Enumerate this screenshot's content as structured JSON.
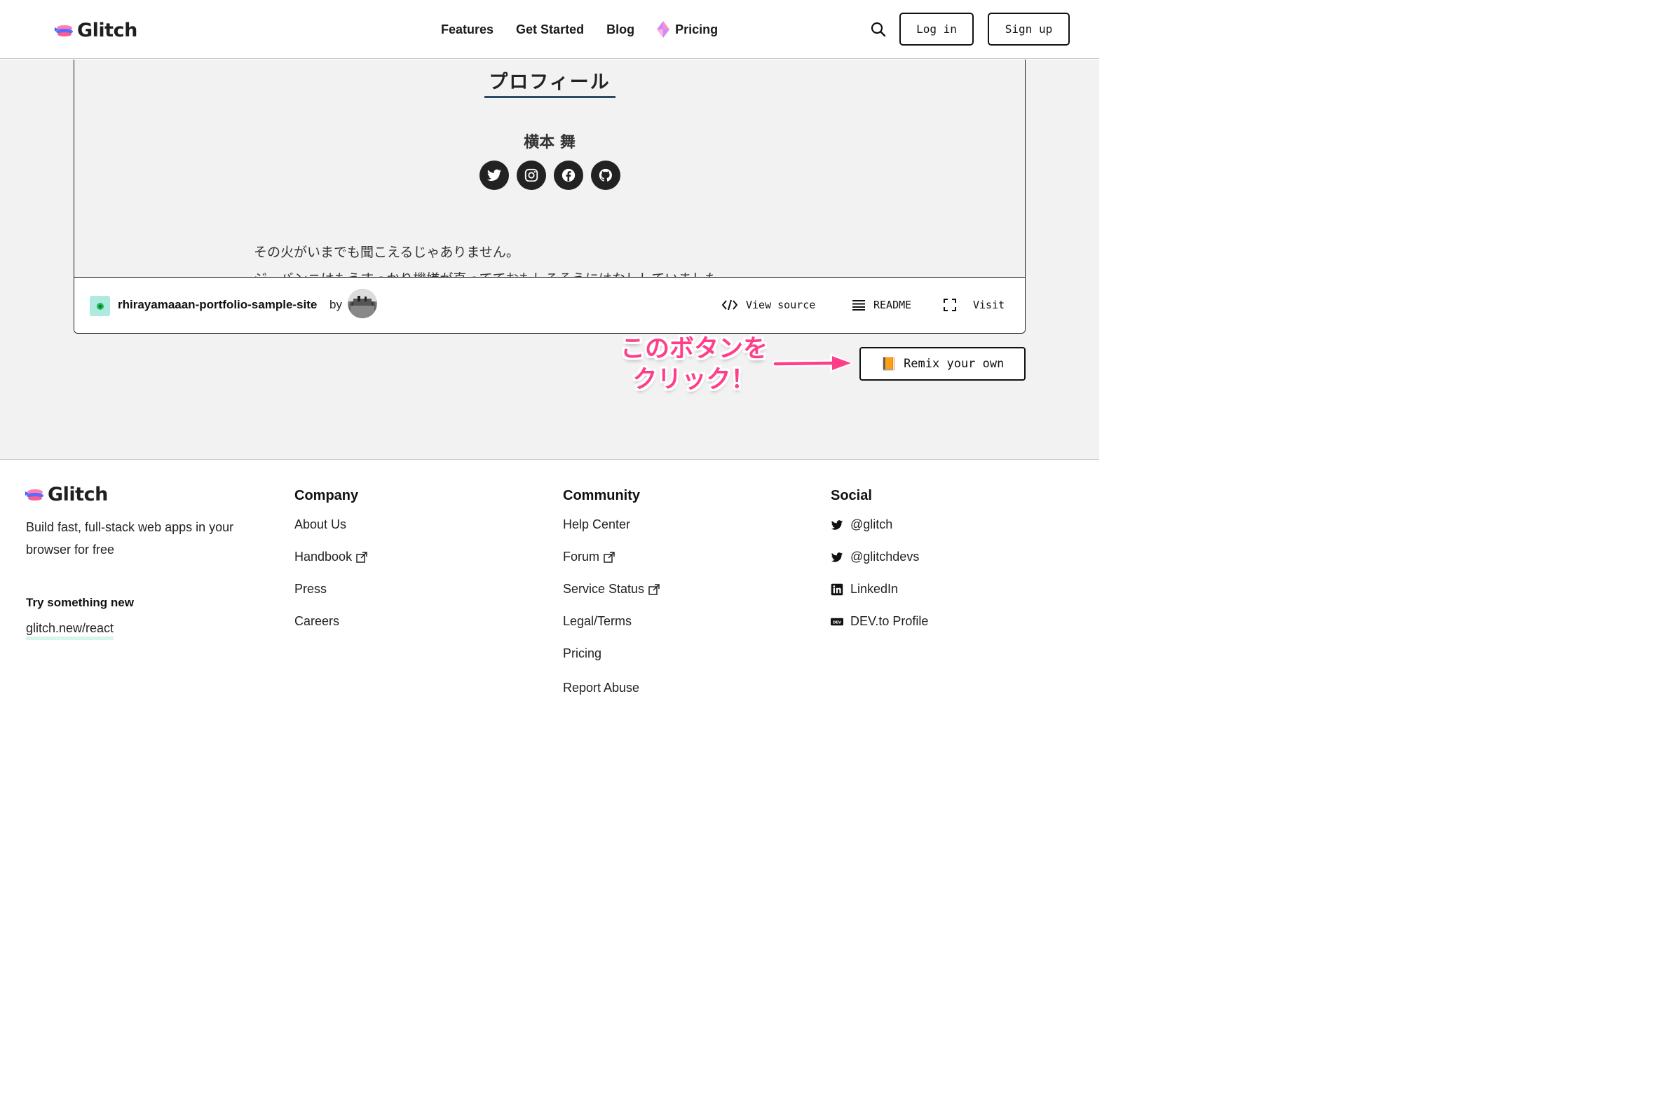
{
  "header": {
    "logo_text": "Glitch",
    "nav": {
      "features": "Features",
      "get_started": "Get Started",
      "blog": "Blog",
      "pricing": "Pricing"
    },
    "login_label": "Log in",
    "signup_label": "Sign up"
  },
  "embed": {
    "profile_title": "プロフィール",
    "profile_name": "横本 舞",
    "social_icons": [
      "twitter-icon",
      "instagram-icon",
      "facebook-icon",
      "github-icon"
    ],
    "body_line1": "その火がいまでも聞こえるじゃありません。",
    "body_line2": "ジーバンニはもうすっかり機嫌が直ってておもしろそうにはなししていました。",
    "project_name": "rhirayamaaan-portfolio-sample-site",
    "by_label": "by",
    "view_source": "View source",
    "readme": "README",
    "visit": "Visit"
  },
  "remix": {
    "label": "Remix your own",
    "emoji": "📙"
  },
  "annotation": {
    "line1": "このボタンを",
    "line2": "クリック！",
    "color": "#ff3e8a"
  },
  "footer": {
    "logo_text": "Glitch",
    "tagline": "Build fast, full-stack web apps in your browser for free",
    "try_heading": "Try something new",
    "try_link": "glitch.new/react",
    "company": {
      "heading": "Company",
      "about": "About Us",
      "handbook": "Handbook",
      "press": "Press",
      "careers": "Careers"
    },
    "community": {
      "heading": "Community",
      "help": "Help Center",
      "forum": "Forum",
      "status": "Service Status",
      "legal": "Legal/Terms",
      "pricing": "Pricing",
      "abuse": "Report Abuse"
    },
    "social": {
      "heading": "Social",
      "glitch": "@glitch",
      "glitchdevs": "@glitchdevs",
      "linkedin": "LinkedIn",
      "dev": "DEV.to Profile"
    }
  }
}
